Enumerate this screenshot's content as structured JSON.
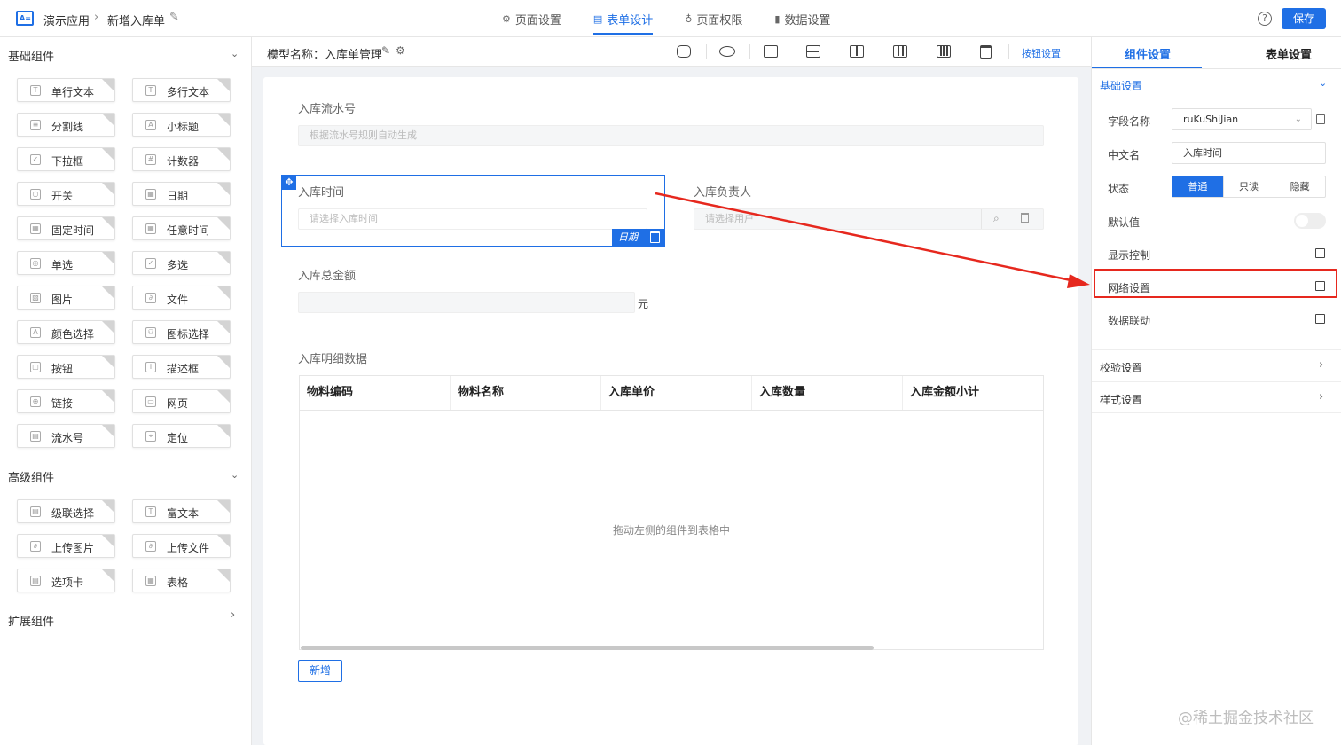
{
  "topbar": {
    "app_name": "演示应用",
    "page_name": "新增入库单",
    "tabs": [
      {
        "label": "页面设置",
        "icon": "gear-icon",
        "glyph": "⚙"
      },
      {
        "label": "表单设计",
        "icon": "document-icon",
        "glyph": "▤"
      },
      {
        "label": "页面权限",
        "icon": "lock-icon",
        "glyph": "♁"
      },
      {
        "label": "数据设置",
        "icon": "bar-chart-icon",
        "glyph": "▮"
      }
    ],
    "active_tab": "表单设计",
    "help_glyph": "?",
    "save_label": "保存"
  },
  "sidebar": {
    "basic_title": "基础组件",
    "basic": [
      {
        "label": "单行文本",
        "icon": "T"
      },
      {
        "label": "多行文本",
        "icon": "T"
      },
      {
        "label": "分割线",
        "icon": "≡"
      },
      {
        "label": "小标题",
        "icon": "A"
      },
      {
        "label": "下拉框",
        "icon": "✓"
      },
      {
        "label": "计数器",
        "icon": "#"
      },
      {
        "label": "开关",
        "icon": "○"
      },
      {
        "label": "日期",
        "icon": "▦"
      },
      {
        "label": "固定时间",
        "icon": "▦"
      },
      {
        "label": "任意时间",
        "icon": "▦"
      },
      {
        "label": "单选",
        "icon": "◎"
      },
      {
        "label": "多选",
        "icon": "✓"
      },
      {
        "label": "图片",
        "icon": "▨"
      },
      {
        "label": "文件",
        "icon": "∂"
      },
      {
        "label": "颜色选择",
        "icon": "A"
      },
      {
        "label": "图标选择",
        "icon": "⚇"
      },
      {
        "label": "按钮",
        "icon": "▢"
      },
      {
        "label": "描述框",
        "icon": "i"
      },
      {
        "label": "链接",
        "icon": "⊕"
      },
      {
        "label": "网页",
        "icon": "▭"
      },
      {
        "label": "流水号",
        "icon": "▤"
      },
      {
        "label": "定位",
        "icon": "⌖"
      }
    ],
    "advanced_title": "高级组件",
    "advanced": [
      {
        "label": "级联选择",
        "icon": "▤"
      },
      {
        "label": "富文本",
        "icon": "T"
      },
      {
        "label": "上传图片",
        "icon": "∂"
      },
      {
        "label": "上传文件",
        "icon": "∂"
      },
      {
        "label": "选项卡",
        "icon": "▤"
      },
      {
        "label": "表格",
        "icon": "▦"
      }
    ],
    "extend_title": "扩展组件"
  },
  "toolbar": {
    "model_label": "模型名称：入库单管理",
    "button_settings": "按钮设置"
  },
  "form": {
    "serial_label": "入库流水号",
    "serial_placeholder": "根据流水号规则自动生成",
    "time_label": "入库时间",
    "time_placeholder": "请选择入库时间",
    "owner_label": "入库负责人",
    "owner_placeholder": "请选择用户",
    "amount_label": "入库总金额",
    "amount_unit": "元",
    "detail_label": "入库明细数据",
    "table_headers": [
      "物料编码",
      "物料名称",
      "入库单价",
      "入库数量",
      "入库金额小计"
    ],
    "table_empty": "拖动左侧的组件到表格中",
    "add_label": "新增",
    "selected_tag": "日期"
  },
  "right_panel": {
    "tab_component": "组件设置",
    "tab_form": "表单设置",
    "basic_settings": "基础设置",
    "field_name_label": "字段名称",
    "field_name_value": "ruKuShiJian",
    "cn_name_label": "中文名",
    "cn_name_value": "入库时间",
    "state_label": "状态",
    "state_options": [
      "普通",
      "只读",
      "隐藏"
    ],
    "state_selected": "普通",
    "default_label": "默认值",
    "display_label": "显示控制",
    "grid_label": "网络设置",
    "linkage_label": "数据联动",
    "validation_label": "校验设置",
    "style_label": "样式设置"
  },
  "watermark": "@稀土掘金技术社区",
  "colors": {
    "accent": "#1f6fe5",
    "annotation": "#e6281e"
  }
}
